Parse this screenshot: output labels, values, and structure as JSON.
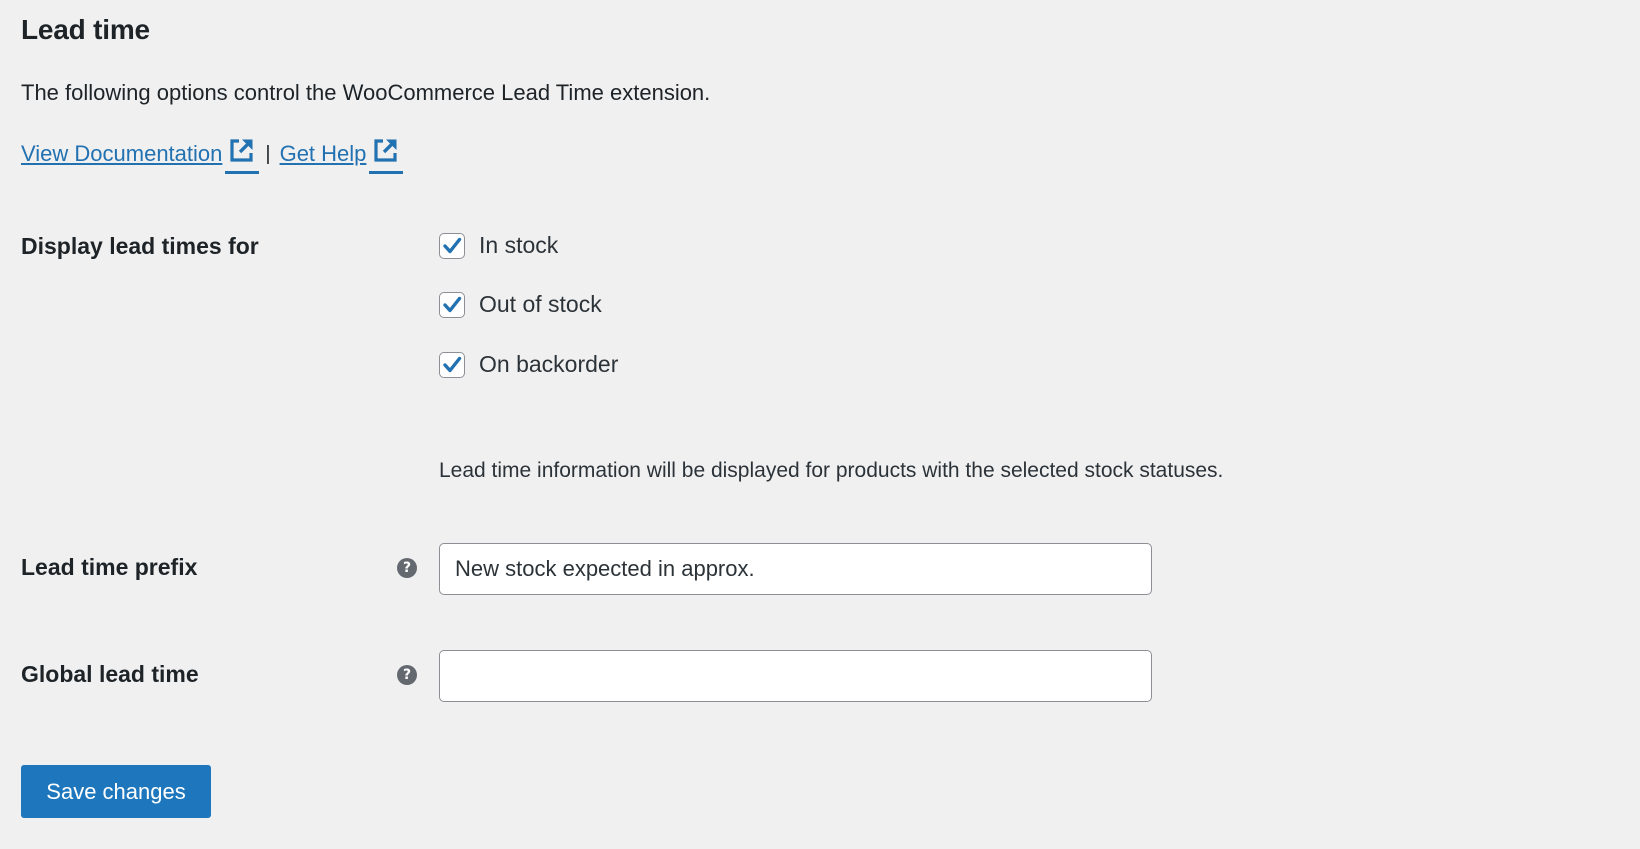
{
  "header": {
    "title": "Lead time",
    "intro": "The following options control the WooCommerce Lead Time extension."
  },
  "links": [
    {
      "label": "View Documentation",
      "icon": "external-link-icon"
    },
    {
      "label": "Get Help",
      "icon": "external-link-icon"
    }
  ],
  "links_separator": "|",
  "display_lead_times": {
    "label": "Display lead times for",
    "options": [
      {
        "label": "In stock",
        "checked": true
      },
      {
        "label": "Out of stock",
        "checked": true
      },
      {
        "label": "On backorder",
        "checked": true
      }
    ],
    "description": "Lead time information will be displayed for products with the selected stock statuses."
  },
  "lead_time_prefix": {
    "label": "Lead time prefix",
    "help_icon": "question-circle-icon",
    "value": "New stock expected in approx."
  },
  "global_lead_time": {
    "label": "Global lead time",
    "help_icon": "question-circle-icon",
    "value": ""
  },
  "save_button": {
    "label": "Save changes"
  },
  "colors": {
    "accent": "#2271b1",
    "button": "#1e77bd",
    "background": "#f0f0f1",
    "help_icon": "#646970"
  }
}
